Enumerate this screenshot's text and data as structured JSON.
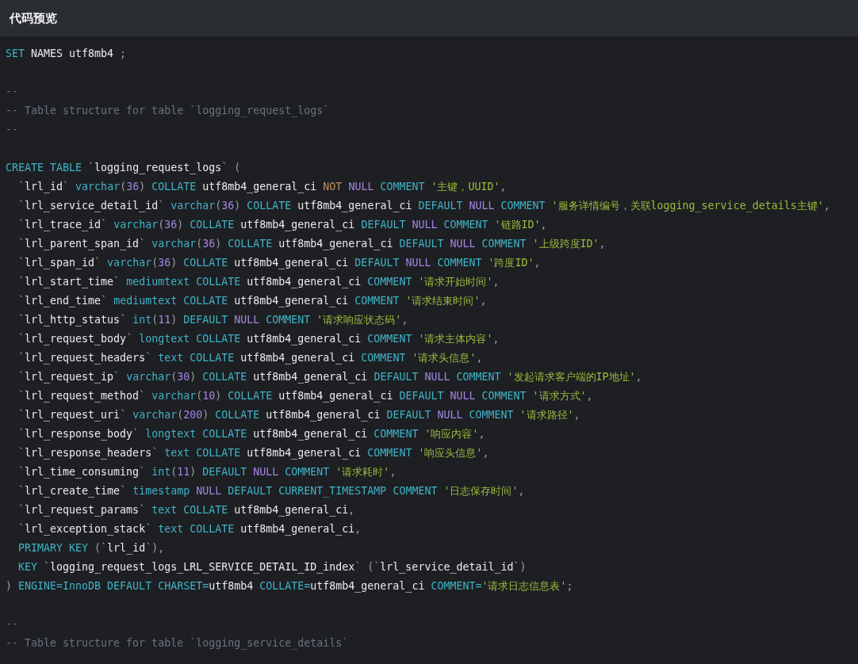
{
  "panel": {
    "title": "代码预览"
  },
  "lines": [
    {
      "kind": "code",
      "tokens": [
        {
          "kind": "kw",
          "text": "SET"
        },
        {
          "kind": "name",
          "text": " NAMES utf8mb4"
        },
        {
          "kind": "punct",
          "text": " ;"
        }
      ]
    },
    {
      "kind": "blank"
    },
    {
      "kind": "code",
      "tokens": [
        {
          "kind": "cmt",
          "text": "--"
        }
      ]
    },
    {
      "kind": "code",
      "tokens": [
        {
          "kind": "cmt",
          "text": "-- Table structure for table `logging_request_logs`"
        }
      ]
    },
    {
      "kind": "code",
      "tokens": [
        {
          "kind": "cmt",
          "text": "--"
        }
      ]
    },
    {
      "kind": "blank"
    },
    {
      "kind": "code",
      "tokens": [
        {
          "kind": "kw",
          "text": "CREATE TABLE"
        },
        {
          "kind": "punct",
          "text": " `"
        },
        {
          "kind": "name",
          "text": "logging_request_logs"
        },
        {
          "kind": "punct",
          "text": "` ("
        }
      ]
    },
    {
      "kind": "code",
      "tokens": [
        {
          "kind": "punct",
          "text": "  `"
        },
        {
          "kind": "name",
          "text": "lrl_id"
        },
        {
          "kind": "punct",
          "text": "`"
        },
        {
          "kind": "kw",
          "text": " varchar"
        },
        {
          "kind": "punct",
          "text": "("
        },
        {
          "kind": "const",
          "text": "36"
        },
        {
          "kind": "punct",
          "text": ")"
        },
        {
          "kind": "kw",
          "text": " COLLATE"
        },
        {
          "kind": "name",
          "text": " utf8mb4_general_ci"
        },
        {
          "kind": "op",
          "text": " NOT"
        },
        {
          "kind": "const",
          "text": " NULL"
        },
        {
          "kind": "kw",
          "text": " COMMENT"
        },
        {
          "kind": "str",
          "text": " '主键，UUID'"
        },
        {
          "kind": "punct",
          "text": ","
        }
      ]
    },
    {
      "kind": "code",
      "tokens": [
        {
          "kind": "punct",
          "text": "  `"
        },
        {
          "kind": "name",
          "text": "lrl_service_detail_id"
        },
        {
          "kind": "punct",
          "text": "`"
        },
        {
          "kind": "kw",
          "text": " varchar"
        },
        {
          "kind": "punct",
          "text": "("
        },
        {
          "kind": "const",
          "text": "36"
        },
        {
          "kind": "punct",
          "text": ")"
        },
        {
          "kind": "kw",
          "text": " COLLATE"
        },
        {
          "kind": "name",
          "text": " utf8mb4_general_ci"
        },
        {
          "kind": "kw",
          "text": " DEFAULT"
        },
        {
          "kind": "const",
          "text": " NULL"
        },
        {
          "kind": "kw",
          "text": " COMMENT"
        },
        {
          "kind": "str",
          "text": " '服务详情编号，关联logging_service_details主键'"
        },
        {
          "kind": "punct",
          "text": ","
        }
      ]
    },
    {
      "kind": "code",
      "tokens": [
        {
          "kind": "punct",
          "text": "  `"
        },
        {
          "kind": "name",
          "text": "lrl_trace_id"
        },
        {
          "kind": "punct",
          "text": "`"
        },
        {
          "kind": "kw",
          "text": " varchar"
        },
        {
          "kind": "punct",
          "text": "("
        },
        {
          "kind": "const",
          "text": "36"
        },
        {
          "kind": "punct",
          "text": ")"
        },
        {
          "kind": "kw",
          "text": " COLLATE"
        },
        {
          "kind": "name",
          "text": " utf8mb4_general_ci"
        },
        {
          "kind": "kw",
          "text": " DEFAULT"
        },
        {
          "kind": "const",
          "text": " NULL"
        },
        {
          "kind": "kw",
          "text": " COMMENT"
        },
        {
          "kind": "str",
          "text": " '链路ID'"
        },
        {
          "kind": "punct",
          "text": ","
        }
      ]
    },
    {
      "kind": "code",
      "tokens": [
        {
          "kind": "punct",
          "text": "  `"
        },
        {
          "kind": "name",
          "text": "lrl_parent_span_id"
        },
        {
          "kind": "punct",
          "text": "`"
        },
        {
          "kind": "kw",
          "text": " varchar"
        },
        {
          "kind": "punct",
          "text": "("
        },
        {
          "kind": "const",
          "text": "36"
        },
        {
          "kind": "punct",
          "text": ")"
        },
        {
          "kind": "kw",
          "text": " COLLATE"
        },
        {
          "kind": "name",
          "text": " utf8mb4_general_ci"
        },
        {
          "kind": "kw",
          "text": " DEFAULT"
        },
        {
          "kind": "const",
          "text": " NULL"
        },
        {
          "kind": "kw",
          "text": " COMMENT"
        },
        {
          "kind": "str",
          "text": " '上级跨度ID'"
        },
        {
          "kind": "punct",
          "text": ","
        }
      ]
    },
    {
      "kind": "code",
      "tokens": [
        {
          "kind": "punct",
          "text": "  `"
        },
        {
          "kind": "name",
          "text": "lrl_span_id"
        },
        {
          "kind": "punct",
          "text": "`"
        },
        {
          "kind": "kw",
          "text": " varchar"
        },
        {
          "kind": "punct",
          "text": "("
        },
        {
          "kind": "const",
          "text": "36"
        },
        {
          "kind": "punct",
          "text": ")"
        },
        {
          "kind": "kw",
          "text": " COLLATE"
        },
        {
          "kind": "name",
          "text": " utf8mb4_general_ci"
        },
        {
          "kind": "kw",
          "text": " DEFAULT"
        },
        {
          "kind": "const",
          "text": " NULL"
        },
        {
          "kind": "kw",
          "text": " COMMENT"
        },
        {
          "kind": "str",
          "text": " '跨度ID'"
        },
        {
          "kind": "punct",
          "text": ","
        }
      ]
    },
    {
      "kind": "code",
      "tokens": [
        {
          "kind": "punct",
          "text": "  `"
        },
        {
          "kind": "name",
          "text": "lrl_start_time"
        },
        {
          "kind": "punct",
          "text": "`"
        },
        {
          "kind": "kw",
          "text": " mediumtext COLLATE"
        },
        {
          "kind": "name",
          "text": " utf8mb4_general_ci"
        },
        {
          "kind": "kw",
          "text": " COMMENT"
        },
        {
          "kind": "str",
          "text": " '请求开始时间'"
        },
        {
          "kind": "punct",
          "text": ","
        }
      ]
    },
    {
      "kind": "code",
      "tokens": [
        {
          "kind": "punct",
          "text": "  `"
        },
        {
          "kind": "name",
          "text": "lrl_end_time"
        },
        {
          "kind": "punct",
          "text": "`"
        },
        {
          "kind": "kw",
          "text": " mediumtext COLLATE"
        },
        {
          "kind": "name",
          "text": " utf8mb4_general_ci"
        },
        {
          "kind": "kw",
          "text": " COMMENT"
        },
        {
          "kind": "str",
          "text": " '请求结束时间'"
        },
        {
          "kind": "punct",
          "text": ","
        }
      ]
    },
    {
      "kind": "code",
      "tokens": [
        {
          "kind": "punct",
          "text": "  `"
        },
        {
          "kind": "name",
          "text": "lrl_http_status"
        },
        {
          "kind": "punct",
          "text": "`"
        },
        {
          "kind": "kw",
          "text": " int"
        },
        {
          "kind": "punct",
          "text": "("
        },
        {
          "kind": "const",
          "text": "11"
        },
        {
          "kind": "punct",
          "text": ")"
        },
        {
          "kind": "kw",
          "text": " DEFAULT"
        },
        {
          "kind": "const",
          "text": " NULL"
        },
        {
          "kind": "kw",
          "text": " COMMENT"
        },
        {
          "kind": "str",
          "text": " '请求响应状态码'"
        },
        {
          "kind": "punct",
          "text": ","
        }
      ]
    },
    {
      "kind": "code",
      "tokens": [
        {
          "kind": "punct",
          "text": "  `"
        },
        {
          "kind": "name",
          "text": "lrl_request_body"
        },
        {
          "kind": "punct",
          "text": "`"
        },
        {
          "kind": "kw",
          "text": " longtext COLLATE"
        },
        {
          "kind": "name",
          "text": " utf8mb4_general_ci"
        },
        {
          "kind": "kw",
          "text": " COMMENT"
        },
        {
          "kind": "str",
          "text": " '请求主体内容'"
        },
        {
          "kind": "punct",
          "text": ","
        }
      ]
    },
    {
      "kind": "code",
      "tokens": [
        {
          "kind": "punct",
          "text": "  `"
        },
        {
          "kind": "name",
          "text": "lrl_request_headers"
        },
        {
          "kind": "punct",
          "text": "`"
        },
        {
          "kind": "kw",
          "text": " text COLLATE"
        },
        {
          "kind": "name",
          "text": " utf8mb4_general_ci"
        },
        {
          "kind": "kw",
          "text": " COMMENT"
        },
        {
          "kind": "str",
          "text": " '请求头信息'"
        },
        {
          "kind": "punct",
          "text": ","
        }
      ]
    },
    {
      "kind": "code",
      "tokens": [
        {
          "kind": "punct",
          "text": "  `"
        },
        {
          "kind": "name",
          "text": "lrl_request_ip"
        },
        {
          "kind": "punct",
          "text": "`"
        },
        {
          "kind": "kw",
          "text": " varchar"
        },
        {
          "kind": "punct",
          "text": "("
        },
        {
          "kind": "const",
          "text": "30"
        },
        {
          "kind": "punct",
          "text": ")"
        },
        {
          "kind": "kw",
          "text": " COLLATE"
        },
        {
          "kind": "name",
          "text": " utf8mb4_general_ci"
        },
        {
          "kind": "kw",
          "text": " DEFAULT"
        },
        {
          "kind": "const",
          "text": " NULL"
        },
        {
          "kind": "kw",
          "text": " COMMENT"
        },
        {
          "kind": "str",
          "text": " '发起请求客户端的IP地址'"
        },
        {
          "kind": "punct",
          "text": ","
        }
      ]
    },
    {
      "kind": "code",
      "tokens": [
        {
          "kind": "punct",
          "text": "  `"
        },
        {
          "kind": "name",
          "text": "lrl_request_method"
        },
        {
          "kind": "punct",
          "text": "`"
        },
        {
          "kind": "kw",
          "text": " varchar"
        },
        {
          "kind": "punct",
          "text": "("
        },
        {
          "kind": "const",
          "text": "10"
        },
        {
          "kind": "punct",
          "text": ")"
        },
        {
          "kind": "kw",
          "text": " COLLATE"
        },
        {
          "kind": "name",
          "text": " utf8mb4_general_ci"
        },
        {
          "kind": "kw",
          "text": " DEFAULT"
        },
        {
          "kind": "const",
          "text": " NULL"
        },
        {
          "kind": "kw",
          "text": " COMMENT"
        },
        {
          "kind": "str",
          "text": " '请求方式'"
        },
        {
          "kind": "punct",
          "text": ","
        }
      ]
    },
    {
      "kind": "code",
      "tokens": [
        {
          "kind": "punct",
          "text": "  `"
        },
        {
          "kind": "name",
          "text": "lrl_request_uri"
        },
        {
          "kind": "punct",
          "text": "`"
        },
        {
          "kind": "kw",
          "text": " varchar"
        },
        {
          "kind": "punct",
          "text": "("
        },
        {
          "kind": "const",
          "text": "200"
        },
        {
          "kind": "punct",
          "text": ")"
        },
        {
          "kind": "kw",
          "text": " COLLATE"
        },
        {
          "kind": "name",
          "text": " utf8mb4_general_ci"
        },
        {
          "kind": "kw",
          "text": " DEFAULT"
        },
        {
          "kind": "const",
          "text": " NULL"
        },
        {
          "kind": "kw",
          "text": " COMMENT"
        },
        {
          "kind": "str",
          "text": " '请求路径'"
        },
        {
          "kind": "punct",
          "text": ","
        }
      ]
    },
    {
      "kind": "code",
      "tokens": [
        {
          "kind": "punct",
          "text": "  `"
        },
        {
          "kind": "name",
          "text": "lrl_response_body"
        },
        {
          "kind": "punct",
          "text": "`"
        },
        {
          "kind": "kw",
          "text": " longtext COLLATE"
        },
        {
          "kind": "name",
          "text": " utf8mb4_general_ci"
        },
        {
          "kind": "kw",
          "text": " COMMENT"
        },
        {
          "kind": "str",
          "text": " '响应内容'"
        },
        {
          "kind": "punct",
          "text": ","
        }
      ]
    },
    {
      "kind": "code",
      "tokens": [
        {
          "kind": "punct",
          "text": "  `"
        },
        {
          "kind": "name",
          "text": "lrl_response_headers"
        },
        {
          "kind": "punct",
          "text": "`"
        },
        {
          "kind": "kw",
          "text": " text COLLATE"
        },
        {
          "kind": "name",
          "text": " utf8mb4_general_ci"
        },
        {
          "kind": "kw",
          "text": " COMMENT"
        },
        {
          "kind": "str",
          "text": " '响应头信息'"
        },
        {
          "kind": "punct",
          "text": ","
        }
      ]
    },
    {
      "kind": "code",
      "tokens": [
        {
          "kind": "punct",
          "text": "  `"
        },
        {
          "kind": "name",
          "text": "lrl_time_consuming"
        },
        {
          "kind": "punct",
          "text": "`"
        },
        {
          "kind": "kw",
          "text": " int"
        },
        {
          "kind": "punct",
          "text": "("
        },
        {
          "kind": "const",
          "text": "11"
        },
        {
          "kind": "punct",
          "text": ")"
        },
        {
          "kind": "kw",
          "text": " DEFAULT"
        },
        {
          "kind": "const",
          "text": " NULL"
        },
        {
          "kind": "kw",
          "text": " COMMENT"
        },
        {
          "kind": "str",
          "text": " '请求耗时'"
        },
        {
          "kind": "punct",
          "text": ","
        }
      ]
    },
    {
      "kind": "code",
      "tokens": [
        {
          "kind": "punct",
          "text": "  `"
        },
        {
          "kind": "name",
          "text": "lrl_create_time"
        },
        {
          "kind": "punct",
          "text": "`"
        },
        {
          "kind": "kw",
          "text": " timestamp"
        },
        {
          "kind": "const",
          "text": " NULL"
        },
        {
          "kind": "kw",
          "text": " DEFAULT CURRENT_TIMESTAMP COMMENT"
        },
        {
          "kind": "str",
          "text": " '日志保存时间'"
        },
        {
          "kind": "punct",
          "text": ","
        }
      ]
    },
    {
      "kind": "code",
      "tokens": [
        {
          "kind": "punct",
          "text": "  `"
        },
        {
          "kind": "name",
          "text": "lrl_request_params"
        },
        {
          "kind": "punct",
          "text": "`"
        },
        {
          "kind": "kw",
          "text": " text COLLATE"
        },
        {
          "kind": "name",
          "text": " utf8mb4_general_ci"
        },
        {
          "kind": "punct",
          "text": ","
        }
      ]
    },
    {
      "kind": "code",
      "tokens": [
        {
          "kind": "punct",
          "text": "  `"
        },
        {
          "kind": "name",
          "text": "lrl_exception_stack"
        },
        {
          "kind": "punct",
          "text": "`"
        },
        {
          "kind": "kw",
          "text": " text COLLATE"
        },
        {
          "kind": "name",
          "text": " utf8mb4_general_ci"
        },
        {
          "kind": "punct",
          "text": ","
        }
      ]
    },
    {
      "kind": "code",
      "tokens": [
        {
          "kind": "kw",
          "text": "  PRIMARY KEY"
        },
        {
          "kind": "punct",
          "text": " (`"
        },
        {
          "kind": "name",
          "text": "lrl_id"
        },
        {
          "kind": "punct",
          "text": "`),"
        }
      ]
    },
    {
      "kind": "code",
      "tokens": [
        {
          "kind": "kw",
          "text": "  KEY"
        },
        {
          "kind": "punct",
          "text": " `"
        },
        {
          "kind": "name",
          "text": "logging_request_logs_LRL_SERVICE_DETAIL_ID_index"
        },
        {
          "kind": "punct",
          "text": "` (`"
        },
        {
          "kind": "name",
          "text": "lrl_service_detail_id"
        },
        {
          "kind": "punct",
          "text": "`)"
        }
      ]
    },
    {
      "kind": "code",
      "tokens": [
        {
          "kind": "punct",
          "text": ")"
        },
        {
          "kind": "kw",
          "text": " ENGINE=InnoDB DEFAULT CHARSET="
        },
        {
          "kind": "name",
          "text": "utf8mb4"
        },
        {
          "kind": "kw",
          "text": " COLLATE="
        },
        {
          "kind": "name",
          "text": "utf8mb4_general_ci"
        },
        {
          "kind": "kw",
          "text": " COMMENT="
        },
        {
          "kind": "str",
          "text": "'请求日志信息表'"
        },
        {
          "kind": "punct",
          "text": ";"
        }
      ]
    },
    {
      "kind": "blank"
    },
    {
      "kind": "code",
      "tokens": [
        {
          "kind": "cmt",
          "text": "--"
        }
      ]
    },
    {
      "kind": "code",
      "tokens": [
        {
          "kind": "cmt",
          "text": "-- Table structure for table `logging_service_details`"
        }
      ]
    }
  ]
}
